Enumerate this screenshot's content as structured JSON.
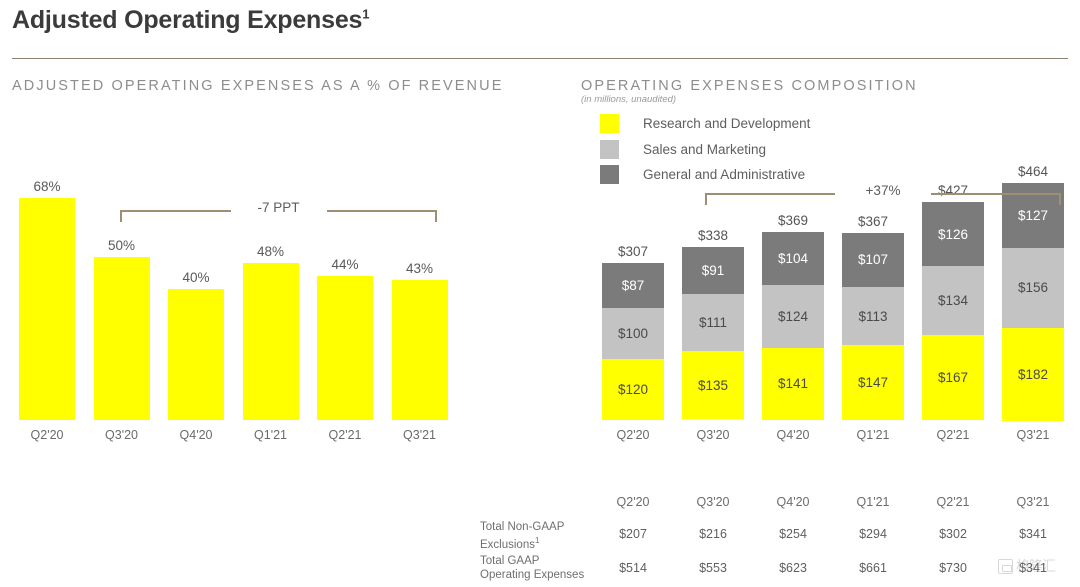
{
  "header": {
    "title": "Adjusted Operating Expenses",
    "title_superscript": "1"
  },
  "left_section": {
    "heading": "ADJUSTED OPERATING EXPENSES AS A % OF REVENUE",
    "annotation": "-7 PPT"
  },
  "right_section": {
    "heading": "OPERATING EXPENSES COMPOSITION",
    "subheading": "(in millions, unaudited)",
    "annotation": "+37%",
    "legend": [
      {
        "label": "Research and Development",
        "color": "#ffff00"
      },
      {
        "label": "Sales and Marketing",
        "color": "#c3c3c3"
      },
      {
        "label": "General and Administrative",
        "color": "#7b7b7b"
      }
    ]
  },
  "table": {
    "columns": [
      "Q2'20",
      "Q3'20",
      "Q4'20",
      "Q1'21",
      "Q2'21",
      "Q3'21"
    ],
    "rows": [
      {
        "label_line1": "Total Non-GAAP",
        "label_line2": "Exclusions",
        "label_superscript": "1",
        "values": [
          "$207",
          "$216",
          "$254",
          "$294",
          "$302",
          "$341"
        ]
      },
      {
        "label_line1": "Total GAAP",
        "label_line2": "Operating Expenses",
        "label_superscript": "",
        "values": [
          "$514",
          "$553",
          "$623",
          "$661",
          "$730",
          "$341"
        ]
      }
    ]
  },
  "watermark": {
    "text": "格隆汇"
  },
  "chart_data": [
    {
      "type": "bar",
      "title": "ADJUSTED OPERATING EXPENSES AS A % OF REVENUE",
      "xlabel": "",
      "ylabel": "",
      "categories": [
        "Q2'20",
        "Q3'20",
        "Q4'20",
        "Q1'21",
        "Q2'21",
        "Q3'21"
      ],
      "values": [
        68,
        50,
        40,
        48,
        44,
        43
      ],
      "value_labels": [
        "68%",
        "50%",
        "40%",
        "48%",
        "44%",
        "43%"
      ],
      "ylim": [
        0,
        68
      ],
      "grid": false,
      "legend": "none",
      "bar_color": "#ffff00",
      "annotations": [
        {
          "text": "-7 PPT",
          "from": "Q2'20",
          "to": "Q3'21",
          "style": "bracket"
        }
      ]
    },
    {
      "type": "bar",
      "subtype": "stacked",
      "title": "OPERATING EXPENSES COMPOSITION",
      "subtitle": "(in millions, unaudited)",
      "xlabel": "",
      "ylabel": "",
      "unit": "millions USD",
      "categories": [
        "Q2'20",
        "Q3'20",
        "Q4'20",
        "Q1'21",
        "Q2'21",
        "Q3'21"
      ],
      "series": [
        {
          "name": "Research and Development",
          "color": "#ffff00",
          "values": [
            120,
            135,
            141,
            147,
            167,
            182
          ],
          "labels": [
            "$120",
            "$135",
            "$141",
            "$147",
            "$167",
            "$182"
          ]
        },
        {
          "name": "Sales and Marketing",
          "color": "#c3c3c3",
          "values": [
            100,
            111,
            124,
            113,
            134,
            156
          ],
          "labels": [
            "$100",
            "$111",
            "$124",
            "$113",
            "$134",
            "$156"
          ]
        },
        {
          "name": "General and Administrative",
          "color": "#7b7b7b",
          "values": [
            87,
            91,
            104,
            107,
            126,
            127
          ],
          "labels": [
            "$87",
            "$91",
            "$104",
            "$107",
            "$126",
            "$127"
          ]
        }
      ],
      "totals": [
        307,
        338,
        369,
        367,
        427,
        464
      ],
      "total_labels": [
        "$307",
        "$338",
        "$369",
        "$367",
        "$427",
        "$464"
      ],
      "ylim": [
        0,
        464
      ],
      "grid": false,
      "legend": "top-left",
      "annotations": [
        {
          "text": "+37%",
          "from": "Q2'20",
          "to": "Q3'21",
          "style": "bracket"
        }
      ]
    },
    {
      "type": "table",
      "columns": [
        "Q2'20",
        "Q3'20",
        "Q4'20",
        "Q1'21",
        "Q2'21",
        "Q3'21"
      ],
      "rows": [
        {
          "label": "Total Non-GAAP Exclusions1",
          "values": [
            "$207",
            "$216",
            "$254",
            "$294",
            "$302",
            "$341"
          ]
        },
        {
          "label": "Total GAAP Operating Expenses",
          "values": [
            "$514",
            "$553",
            "$623",
            "$661",
            "$730",
            "$341"
          ]
        }
      ]
    }
  ]
}
